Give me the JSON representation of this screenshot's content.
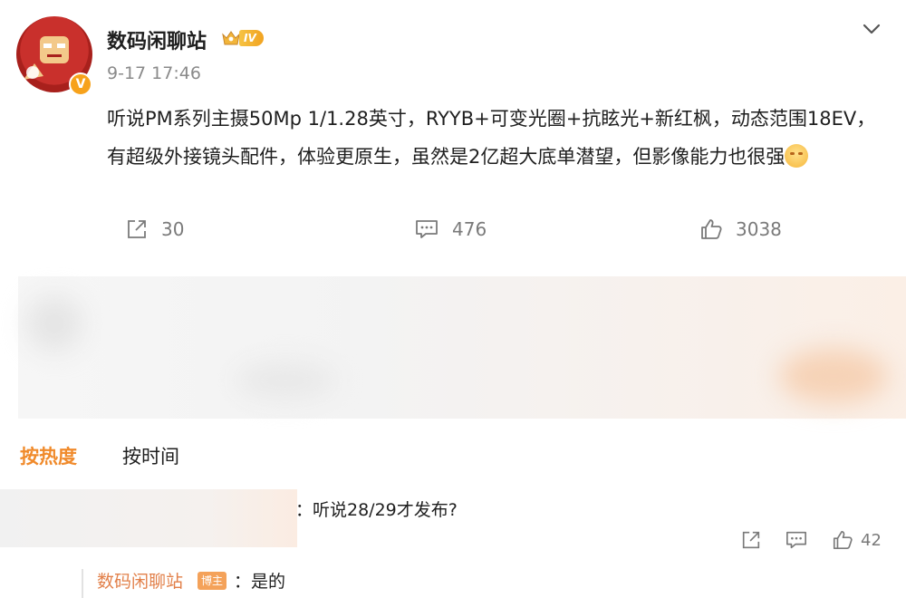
{
  "post": {
    "author": "数码闲聊站",
    "level_badge": "IV",
    "verified_mark": "V",
    "timestamp": "9-17 17:46",
    "text": "听说PM系列主摄50Mp 1/1.28英寸，RYYB+可变光圈+抗眩光+新红枫，动态范围18EV，有超级外接镜头配件，体验更原生，虽然是2亿超大底单潜望，但影像能力也很强",
    "emoji": "yawn-emoji",
    "actions": {
      "repost_count": "30",
      "comment_count": "476",
      "like_count": "3038"
    }
  },
  "comments": {
    "sort_hot": "按热度",
    "sort_time": "按时间",
    "items": [
      {
        "text": "：听说28/29才发布?",
        "actions": {
          "like_count": "42"
        },
        "reply": {
          "author": "数码闲聊站",
          "author_tag": "博主",
          "text": "：是的"
        }
      }
    ]
  },
  "colors": {
    "accent_orange": "#f08a2b",
    "reply_name": "#e2804a",
    "meta_gray": "#8a8a8a"
  },
  "icons": [
    "chevron-down-icon",
    "repost-icon",
    "comment-icon",
    "like-icon",
    "verified-badge-icon",
    "level-crown-icon"
  ]
}
